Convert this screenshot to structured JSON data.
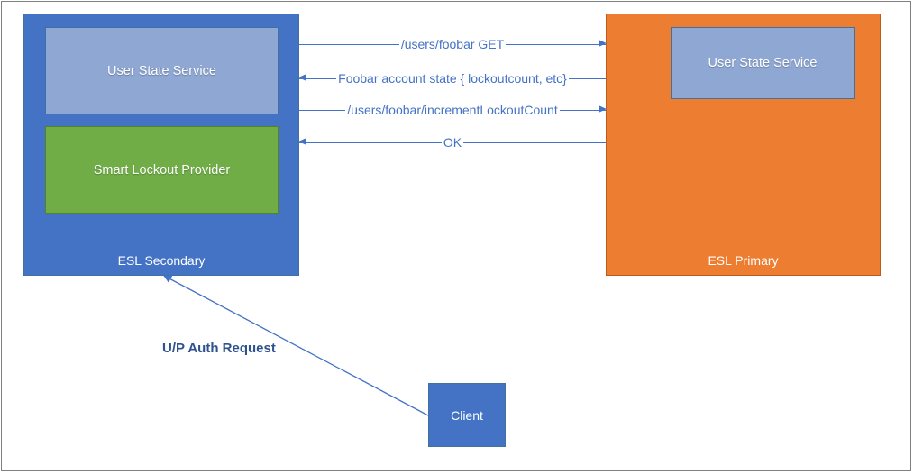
{
  "secondary": {
    "caption": "ESL Secondary",
    "services": {
      "user_state": "User State Service",
      "smart_lockout": "Smart Lockout Provider"
    }
  },
  "primary": {
    "caption": "ESL Primary",
    "services": {
      "user_state": "User State Service"
    }
  },
  "client": {
    "label": "Client",
    "request_label": "U/P Auth Request"
  },
  "messages": {
    "m1": "/users/foobar GET",
    "m2": "Foobar account state { lockoutcount, etc}",
    "m3": "/users/foobar/incrementLockoutCount",
    "m4": "OK"
  },
  "chart_data": {
    "type": "diagram",
    "nodes": [
      {
        "id": "esl-secondary",
        "label": "ESL Secondary",
        "contains": [
          "user-state-service",
          "smart-lockout-provider"
        ]
      },
      {
        "id": "esl-primary",
        "label": "ESL Primary",
        "contains": [
          "user-state-service"
        ]
      },
      {
        "id": "client",
        "label": "Client"
      }
    ],
    "edges": [
      {
        "from": "client",
        "to": "esl-secondary",
        "label": "U/P Auth Request"
      },
      {
        "from": "esl-secondary",
        "to": "esl-primary",
        "label": "/users/foobar GET"
      },
      {
        "from": "esl-primary",
        "to": "esl-secondary",
        "label": "Foobar account state { lockoutcount, etc}"
      },
      {
        "from": "esl-secondary",
        "to": "esl-primary",
        "label": "/users/foobar/incrementLockoutCount"
      },
      {
        "from": "esl-primary",
        "to": "esl-secondary",
        "label": "OK"
      }
    ]
  }
}
